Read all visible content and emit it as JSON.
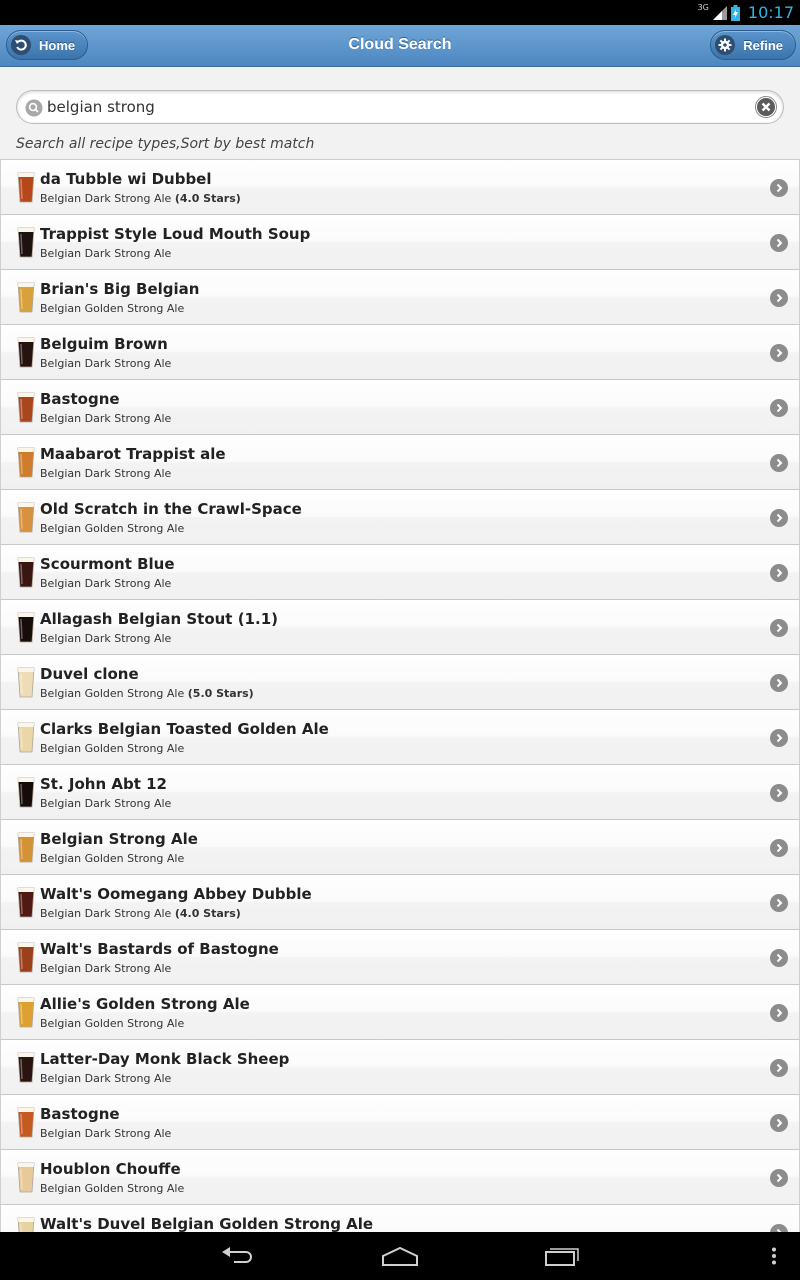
{
  "status_bar": {
    "network": "3G",
    "time": "10:17"
  },
  "header": {
    "title": "Cloud Search",
    "home_label": "Home",
    "refine_label": "Refine"
  },
  "search": {
    "value": "belgian strong",
    "placeholder": "",
    "description": "Search all recipe types,Sort by best match"
  },
  "colors": {
    "header_top": "#6fa6d8",
    "header_bottom": "#4d87c0",
    "statusbar_accent": "#33b5e5"
  },
  "recipes": [
    {
      "title": "da Tubble wi Dubbel",
      "style": "Belgian Dark Strong Ale",
      "rating": "(4.0 Stars)",
      "beer_color": "#b5471a"
    },
    {
      "title": "Trappist Style Loud Mouth Soup",
      "style": "Belgian Dark Strong Ale",
      "rating": "",
      "beer_color": "#1e1210"
    },
    {
      "title": "Brian's Big Belgian",
      "style": "Belgian Golden Strong Ale",
      "rating": "",
      "beer_color": "#d8a13c"
    },
    {
      "title": "Belguim Brown",
      "style": "Belgian Dark Strong Ale",
      "rating": "",
      "beer_color": "#24130e"
    },
    {
      "title": "Bastogne",
      "style": "Belgian Dark Strong Ale",
      "rating": "",
      "beer_color": "#a9461e"
    },
    {
      "title": "Maabarot Trappist ale",
      "style": "Belgian Dark Strong Ale",
      "rating": "",
      "beer_color": "#cf7d2c"
    },
    {
      "title": "Old Scratch in the Crawl-Space",
      "style": "Belgian Golden Strong Ale",
      "rating": "",
      "beer_color": "#d7913f"
    },
    {
      "title": "Scourmont Blue",
      "style": "Belgian Dark Strong Ale",
      "rating": "",
      "beer_color": "#3a1612"
    },
    {
      "title": "Allagash Belgian Stout (1.1)",
      "style": "Belgian Dark Strong Ale",
      "rating": "",
      "beer_color": "#160d0b"
    },
    {
      "title": "Duvel clone",
      "style": "Belgian Golden Strong Ale",
      "rating": "(5.0 Stars)",
      "beer_color": "#eedcb6"
    },
    {
      "title": "Clarks Belgian Toasted Golden Ale",
      "style": "Belgian Golden Strong Ale",
      "rating": "",
      "beer_color": "#ead6a8"
    },
    {
      "title": "St. John Abt 12",
      "style": "Belgian Dark Strong Ale",
      "rating": "",
      "beer_color": "#150c0a"
    },
    {
      "title": "Belgian Strong Ale",
      "style": "Belgian Golden Strong Ale",
      "rating": "",
      "beer_color": "#d39233"
    },
    {
      "title": "Walt's Oomegang Abbey Dubble",
      "style": "Belgian Dark Strong Ale",
      "rating": "(4.0 Stars)",
      "beer_color": "#521812"
    },
    {
      "title": "Walt's Bastards of Bastogne",
      "style": "Belgian Dark Strong Ale",
      "rating": "",
      "beer_color": "#9c3f1b"
    },
    {
      "title": "Allie's Golden Strong Ale",
      "style": "Belgian Golden Strong Ale",
      "rating": "",
      "beer_color": "#dea030"
    },
    {
      "title": "Latter-Day Monk Black Sheep",
      "style": "Belgian Dark Strong Ale",
      "rating": "",
      "beer_color": "#2a1310"
    },
    {
      "title": "Bastogne",
      "style": "Belgian Dark Strong Ale",
      "rating": "",
      "beer_color": "#c45a1f"
    },
    {
      "title": "Houblon Chouffe",
      "style": "Belgian Golden Strong Ale",
      "rating": "",
      "beer_color": "#e8c99a"
    },
    {
      "title": "Walt's Duvel Belgian Golden Strong Ale",
      "style": "",
      "rating": "",
      "beer_color": "#e7d2a2"
    }
  ]
}
